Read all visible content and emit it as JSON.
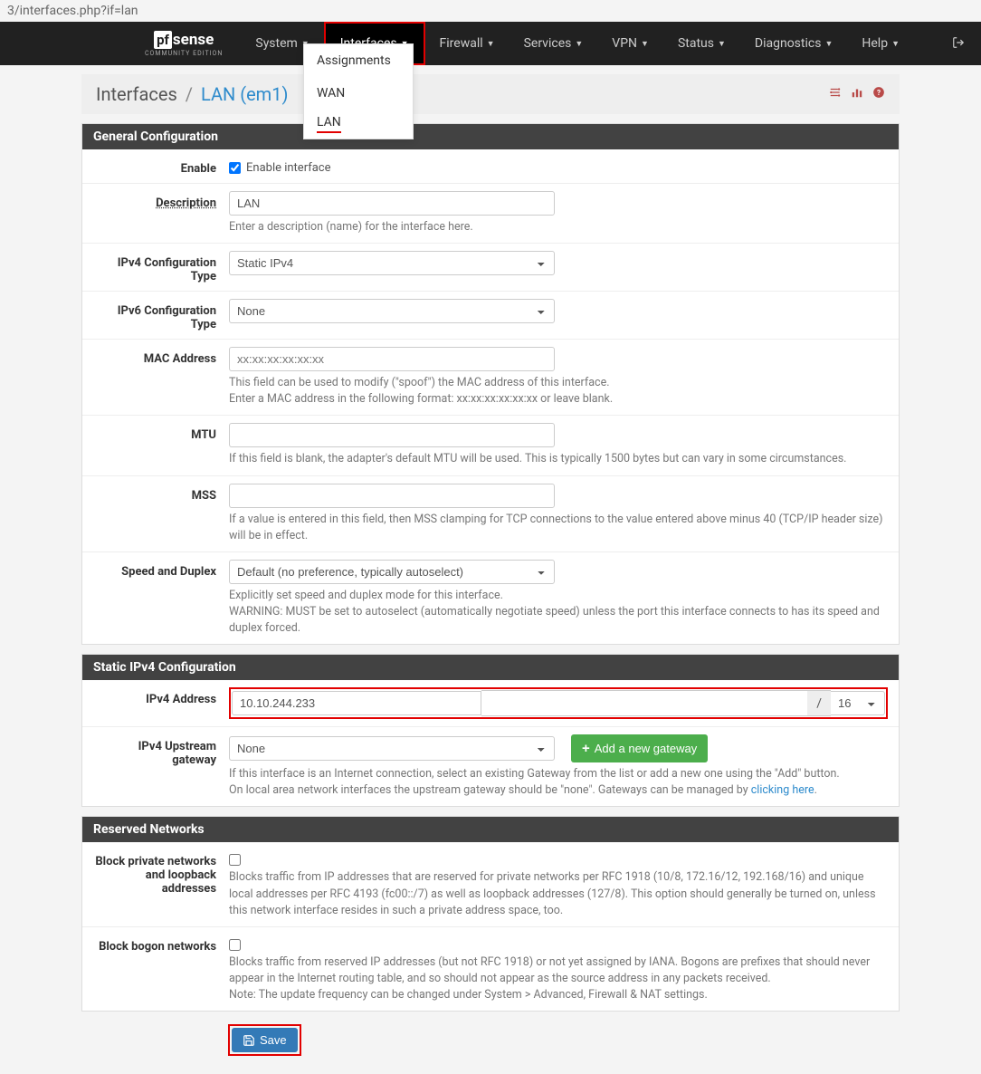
{
  "url": "3/interfaces.php?if=lan",
  "brand": {
    "pf": "pf",
    "sense": "sense",
    "sub": "COMMUNITY EDITION"
  },
  "nav": {
    "items": [
      "System",
      "Interfaces",
      "Firewall",
      "Services",
      "VPN",
      "Status",
      "Diagnostics",
      "Help"
    ],
    "dropdown": [
      "Assignments",
      "WAN",
      "LAN"
    ]
  },
  "breadcrumb": {
    "root": "Interfaces",
    "current": "LAN (em1)"
  },
  "panels": {
    "general": {
      "title": "General Configuration",
      "enable": {
        "label": "Enable",
        "text": "Enable interface",
        "checked": true
      },
      "description": {
        "label": "Description",
        "value": "LAN",
        "help": "Enter a description (name) for the interface here."
      },
      "ipv4type": {
        "label": "IPv4 Configuration Type",
        "value": "Static IPv4"
      },
      "ipv6type": {
        "label": "IPv6 Configuration Type",
        "value": "None"
      },
      "mac": {
        "label": "MAC Address",
        "placeholder": "xx:xx:xx:xx:xx:xx",
        "help1": "This field can be used to modify (\"spoof\") the MAC address of this interface.",
        "help2": "Enter a MAC address in the following format: xx:xx:xx:xx:xx:xx or leave blank."
      },
      "mtu": {
        "label": "MTU",
        "help": "If this field is blank, the adapter's default MTU will be used. This is typically 1500 bytes but can vary in some circumstances."
      },
      "mss": {
        "label": "MSS",
        "help": "If a value is entered in this field, then MSS clamping for TCP connections to the value entered above minus 40 (TCP/IP header size) will be in effect."
      },
      "speed": {
        "label": "Speed and Duplex",
        "value": "Default (no preference, typically autoselect)",
        "help1": "Explicitly set speed and duplex mode for this interface.",
        "help2": "WARNING: MUST be set to autoselect (automatically negotiate speed) unless the port this interface connects to has its speed and duplex forced."
      }
    },
    "static": {
      "title": "Static IPv4 Configuration",
      "ipv4addr": {
        "label": "IPv4 Address",
        "value": "10.10.244.233",
        "slash": "/",
        "mask": "16"
      },
      "gateway": {
        "label": "IPv4 Upstream gateway",
        "value": "None",
        "button": "Add a new gateway",
        "help1": "If this interface is an Internet connection, select an existing Gateway from the list or add a new one using the \"Add\" button.",
        "help2a": "On local area network interfaces the upstream gateway should be \"none\". Gateways can be managed by ",
        "help2link": "clicking here",
        "help2b": "."
      }
    },
    "reserved": {
      "title": "Reserved Networks",
      "private": {
        "label": "Block private networks and loopback addresses",
        "help": "Blocks traffic from IP addresses that are reserved for private networks per RFC 1918 (10/8, 172.16/12, 192.168/16) and unique local addresses per RFC 4193 (fc00::/7) as well as loopback addresses (127/8). This option should generally be turned on, unless this network interface resides in such a private address space, too."
      },
      "bogon": {
        "label": "Block bogon networks",
        "help1": "Blocks traffic from reserved IP addresses (but not RFC 1918) or not yet assigned by IANA. Bogons are prefixes that should never appear in the Internet routing table, and so should not appear as the source address in any packets received.",
        "help2": "Note: The update frequency can be changed under System > Advanced, Firewall & NAT settings."
      }
    }
  },
  "save": "Save"
}
